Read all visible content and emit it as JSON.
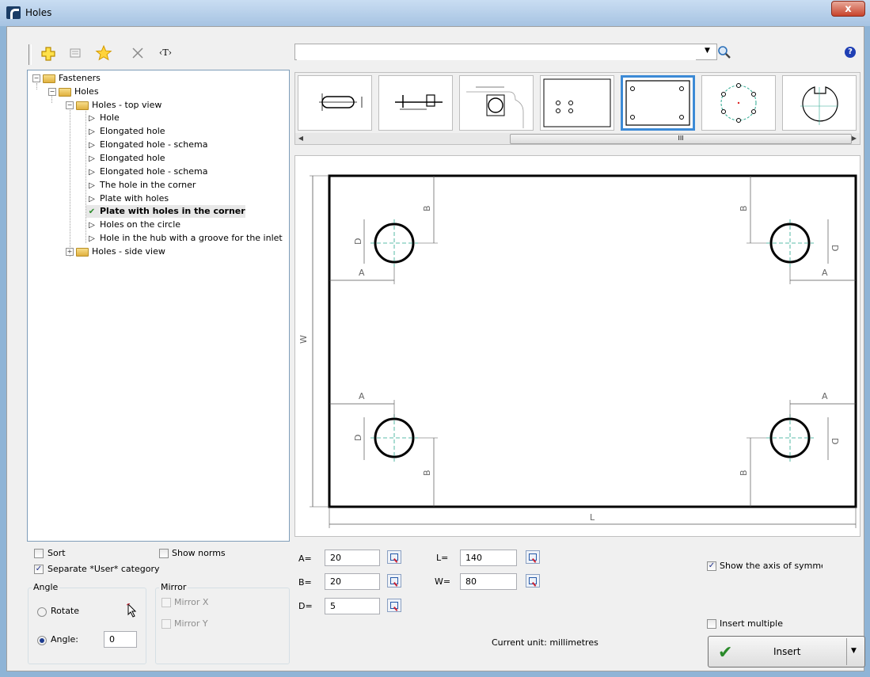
{
  "window": {
    "title": "Holes",
    "close_label": "x"
  },
  "toolbar": {
    "search_value": "",
    "help_label": "?",
    "text_tool_label": "‹T›"
  },
  "tree": {
    "root": "Fasteners",
    "holes": "Holes",
    "top_view": "Holes - top view",
    "items": [
      "Hole",
      "Elongated hole",
      "Elongated hole - schema",
      "Elongated hole",
      "Elongated hole - schema",
      "The hole in the corner",
      "Plate with holes",
      "Plate with holes in the corner",
      "Holes on the circle",
      "Hole in the hub with a groove for the inlet"
    ],
    "side_view": "Holes - side view",
    "selected_index": 7
  },
  "thumbnails": {
    "scroll_label": "III",
    "selected_index": 4
  },
  "preview": {
    "labels": {
      "A": "A",
      "B": "B",
      "D": "D",
      "W": "W",
      "L": "L"
    }
  },
  "options": {
    "sort_label": "Sort",
    "sort_checked": false,
    "show_norms_label": "Show norms",
    "show_norms_checked": false,
    "separate_user_label": "Separate *User* category",
    "separate_user_checked": true
  },
  "angle": {
    "group_label": "Angle",
    "rotate_label": "Rotate",
    "angle_label": "Angle:",
    "angle_value": "0",
    "mode": "angle"
  },
  "mirror": {
    "group_label": "Mirror",
    "mirror_x_label": "Mirror X",
    "mirror_y_label": "Mirror Y"
  },
  "params": {
    "A": {
      "label": "A=",
      "value": "20"
    },
    "B": {
      "label": "B=",
      "value": "20"
    },
    "D": {
      "label": "D=",
      "value": "5"
    },
    "L": {
      "label": "L=",
      "value": "140"
    },
    "W": {
      "label": "W=",
      "value": "80"
    }
  },
  "right_options": {
    "show_axis_label": "Show the axis of symmetr",
    "show_axis_checked": true,
    "insert_multiple_label": "Insert multiple",
    "insert_multiple_checked": false
  },
  "status": {
    "current_unit": "Current unit: millimetres"
  },
  "insert_button": {
    "label": "Insert"
  },
  "colors": {
    "accent": "#3c8ad6",
    "axis": "#2aa890",
    "check_green": "#2a8a2a",
    "help_blue": "#1f3fb4"
  }
}
